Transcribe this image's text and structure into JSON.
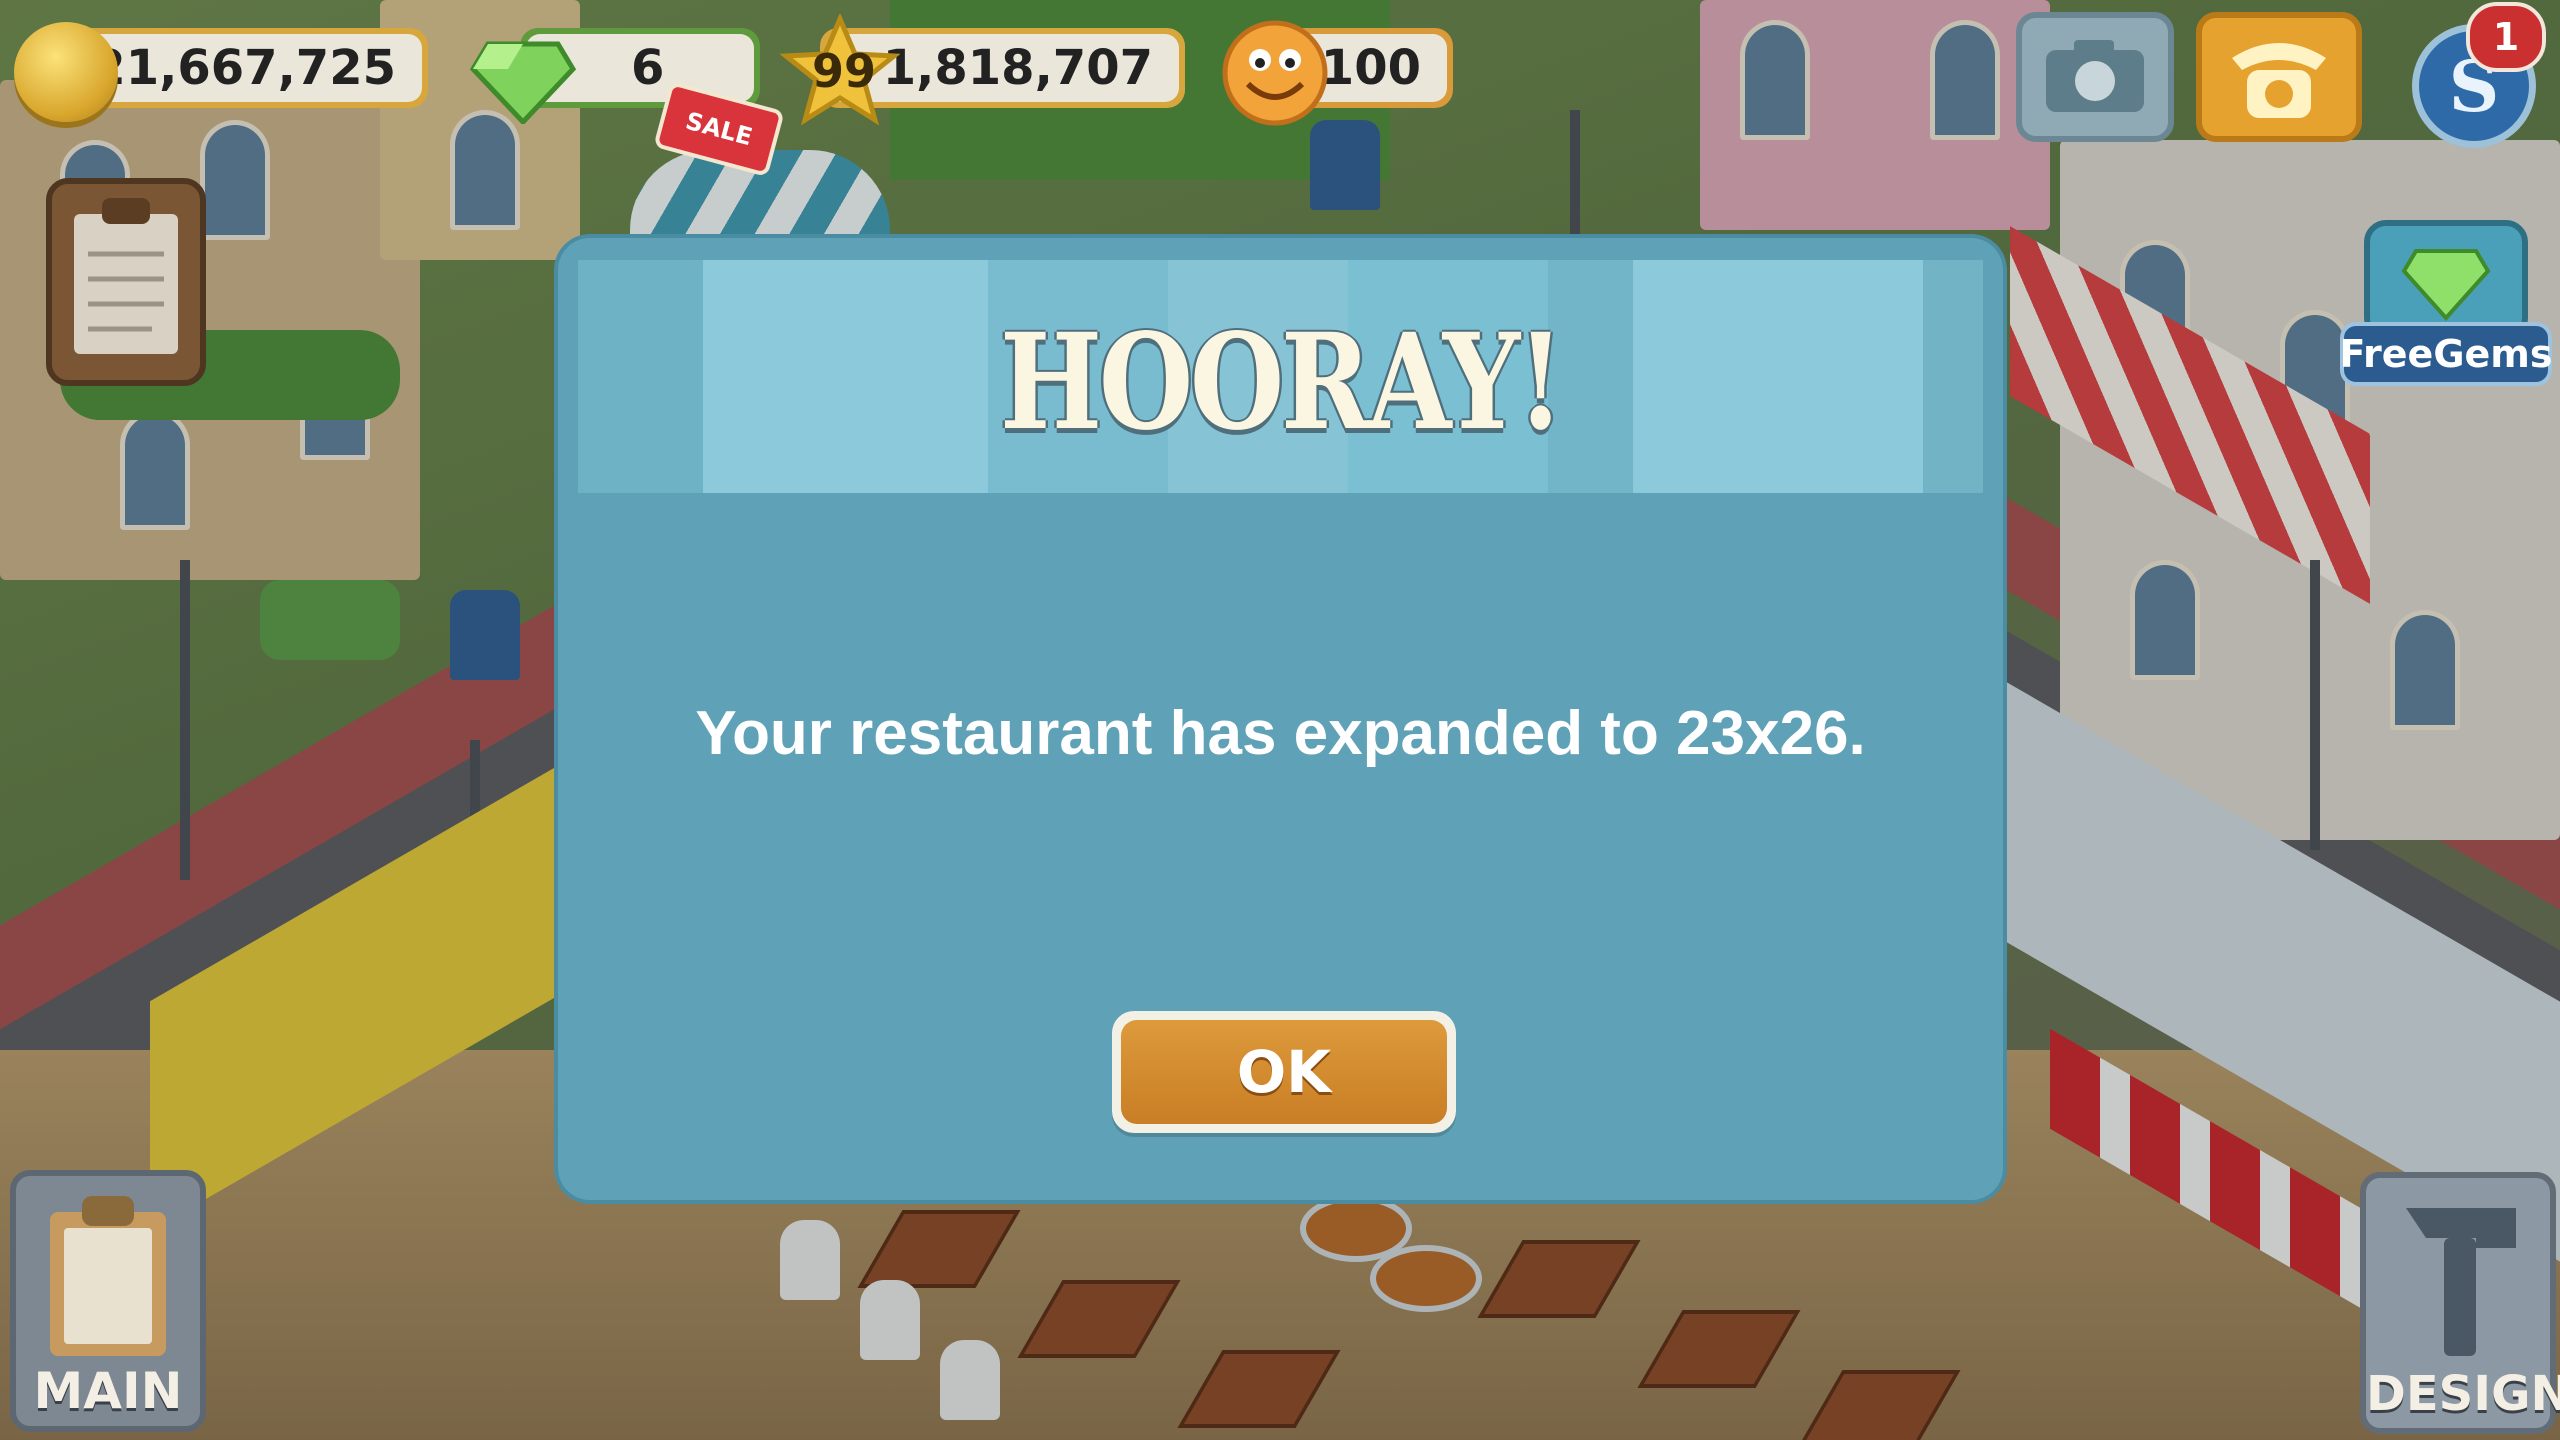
{
  "hud": {
    "coins": "21,667,725",
    "gems": "6",
    "sale_tag": "SALE",
    "level": "99",
    "experience": "1,818,707",
    "happiness": "100",
    "notification_count": "1"
  },
  "right_panel": {
    "free_gems_label": "FreeGems"
  },
  "dialog": {
    "title": "HOORAY!",
    "message": "Your restaurant has expanded to 23x26.",
    "ok_label": "OK"
  },
  "bottom_buttons": {
    "main_label": "MAIN",
    "design_label": "DESIGN"
  },
  "colors": {
    "dialog_bg": "#5fa1b6",
    "dialog_header": "#7abfd2",
    "ok_button": "#d18a30",
    "coin_gold": "#d7a63c",
    "gem_green": "#5f9a3c"
  }
}
